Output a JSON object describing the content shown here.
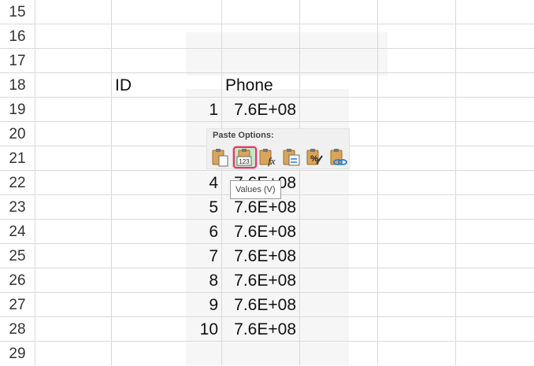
{
  "rows": [
    {
      "num": "15",
      "id": "",
      "value": ""
    },
    {
      "num": "16",
      "id": "",
      "value": ""
    },
    {
      "num": "17",
      "id": "",
      "value": ""
    },
    {
      "num": "18",
      "id": "ID",
      "value": "Phone"
    },
    {
      "num": "19",
      "id": "1",
      "value": "7.6E+08"
    },
    {
      "num": "20",
      "id": "",
      "value": ""
    },
    {
      "num": "21",
      "id": "",
      "value": ""
    },
    {
      "num": "22",
      "id": "4",
      "value": "7.6E+08"
    },
    {
      "num": "23",
      "id": "5",
      "value": "7.6E+08"
    },
    {
      "num": "24",
      "id": "6",
      "value": "7.6E+08"
    },
    {
      "num": "25",
      "id": "7",
      "value": "7.6E+08"
    },
    {
      "num": "26",
      "id": "8",
      "value": "7.6E+08"
    },
    {
      "num": "27",
      "id": "9",
      "value": "7.6E+08"
    },
    {
      "num": "28",
      "id": "10",
      "value": "7.6E+08"
    },
    {
      "num": "29",
      "id": "",
      "value": ""
    }
  ],
  "paste_options": {
    "title": "Paste Options:",
    "buttons": [
      {
        "icon": "paste-icon"
      },
      {
        "icon": "paste-values-icon",
        "number": "123"
      },
      {
        "icon": "paste-formulas-icon"
      },
      {
        "icon": "transpose-icon"
      },
      {
        "icon": "paste-formatting-icon"
      },
      {
        "icon": "paste-link-icon"
      }
    ]
  },
  "tooltip": "Values (V)",
  "colors": {
    "highlight_border": "#e2386b",
    "clipboard": "#d8a55a",
    "paper": "#ffffff"
  }
}
